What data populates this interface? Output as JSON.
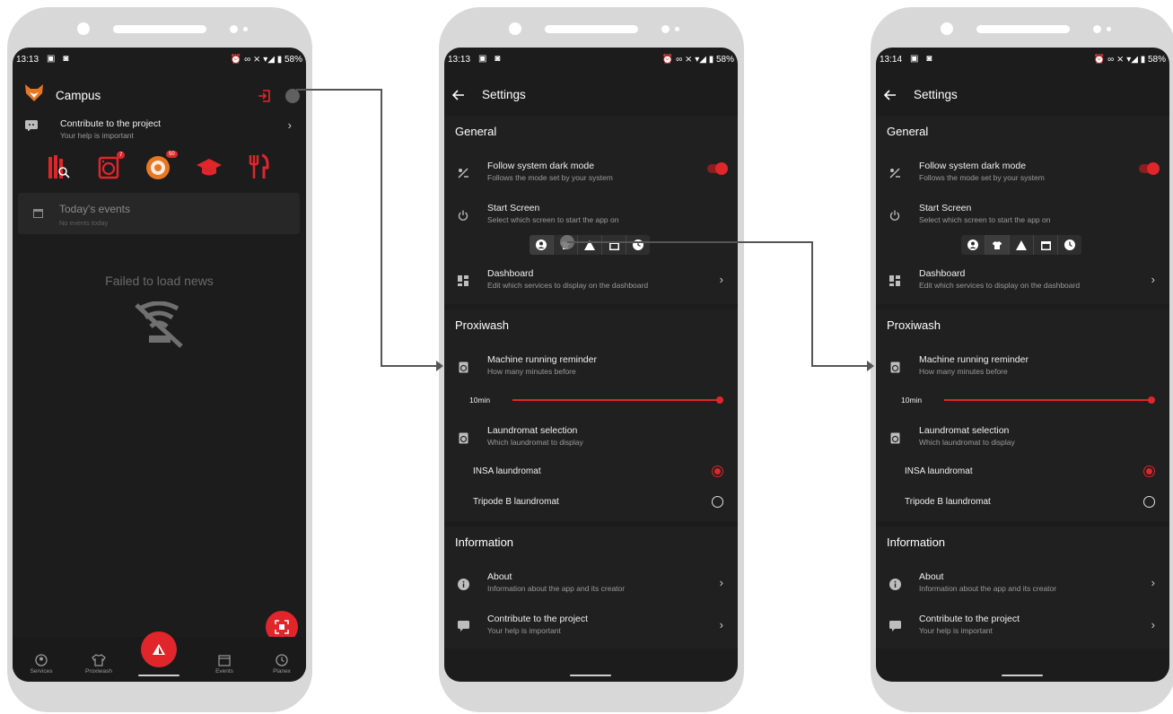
{
  "colors": {
    "accent": "#e0262b",
    "background": "#1c1c1c",
    "surface": "#202020",
    "frame": "#d8d8d8"
  },
  "screen1": {
    "status": {
      "time": "13:13",
      "battery": "58%"
    },
    "header": {
      "title": "Campus"
    },
    "contribute": {
      "title": "Contribute to the project",
      "subtitle": "Your help is important"
    },
    "dashboard_icons": [
      {
        "name": "library-icon",
        "badge": ""
      },
      {
        "name": "washing-machine-icon",
        "badge": "7"
      },
      {
        "name": "tutorinsa-icon",
        "badge": "50"
      },
      {
        "name": "graduation-cap-icon",
        "badge": ""
      },
      {
        "name": "restaurant-icon",
        "badge": ""
      }
    ],
    "events": {
      "title": "Today's events",
      "subtitle": "No events today"
    },
    "news_error": "Failed to load news",
    "nav": [
      {
        "label": "Services",
        "icon": "account-circle-icon"
      },
      {
        "label": "Proxiwash",
        "icon": "tshirt-icon"
      },
      {
        "label": "",
        "icon": "home-triangle-icon"
      },
      {
        "label": "Events",
        "icon": "calendar-icon"
      },
      {
        "label": "Planex",
        "icon": "clock-icon"
      }
    ]
  },
  "screen2": {
    "status": {
      "time": "13:13",
      "battery": "58%"
    },
    "header": {
      "title": "Settings"
    },
    "general": {
      "title": "General",
      "dark_mode": {
        "title": "Follow system dark mode",
        "subtitle": "Follows the mode set by your system",
        "enabled": true
      },
      "start_screen": {
        "title": "Start Screen",
        "subtitle": "Select which screen to start the app on",
        "selected": "services"
      },
      "dashboard": {
        "title": "Dashboard",
        "subtitle": "Edit which services to display on the dashboard"
      }
    },
    "proxiwash": {
      "title": "Proxiwash",
      "reminder": {
        "title": "Machine running reminder",
        "subtitle": "How many minutes before",
        "value_label": "10min",
        "value": 10
      },
      "laundromat": {
        "title": "Laundromat selection",
        "subtitle": "Which laundromat to display"
      },
      "options": [
        {
          "label": "INSA laundromat",
          "selected": true
        },
        {
          "label": "Tripode B laundromat",
          "selected": false
        }
      ]
    },
    "information": {
      "title": "Information",
      "about": {
        "title": "About",
        "subtitle": "Information about the app and its creator"
      },
      "contribute": {
        "title": "Contribute to the project",
        "subtitle": "Your help is important"
      }
    }
  },
  "screen3": {
    "status": {
      "time": "13:14",
      "battery": "58%"
    },
    "header": {
      "title": "Settings"
    },
    "general": {
      "title": "General",
      "dark_mode": {
        "title": "Follow system dark mode",
        "subtitle": "Follows the mode set by your system",
        "enabled": true
      },
      "start_screen": {
        "title": "Start Screen",
        "subtitle": "Select which screen to start the app on",
        "selected": "proxiwash"
      },
      "dashboard": {
        "title": "Dashboard",
        "subtitle": "Edit which services to display on the dashboard"
      }
    },
    "proxiwash": {
      "title": "Proxiwash",
      "reminder": {
        "title": "Machine running reminder",
        "subtitle": "How many minutes before",
        "value_label": "10min",
        "value": 10
      },
      "laundromat": {
        "title": "Laundromat selection",
        "subtitle": "Which laundromat to display"
      },
      "options": [
        {
          "label": "INSA laundromat",
          "selected": true
        },
        {
          "label": "Tripode B laundromat",
          "selected": false
        }
      ]
    },
    "information": {
      "title": "Information",
      "about": {
        "title": "About",
        "subtitle": "Information about the app and its creator"
      },
      "contribute": {
        "title": "Contribute to the project",
        "subtitle": "Your help is important"
      }
    }
  }
}
